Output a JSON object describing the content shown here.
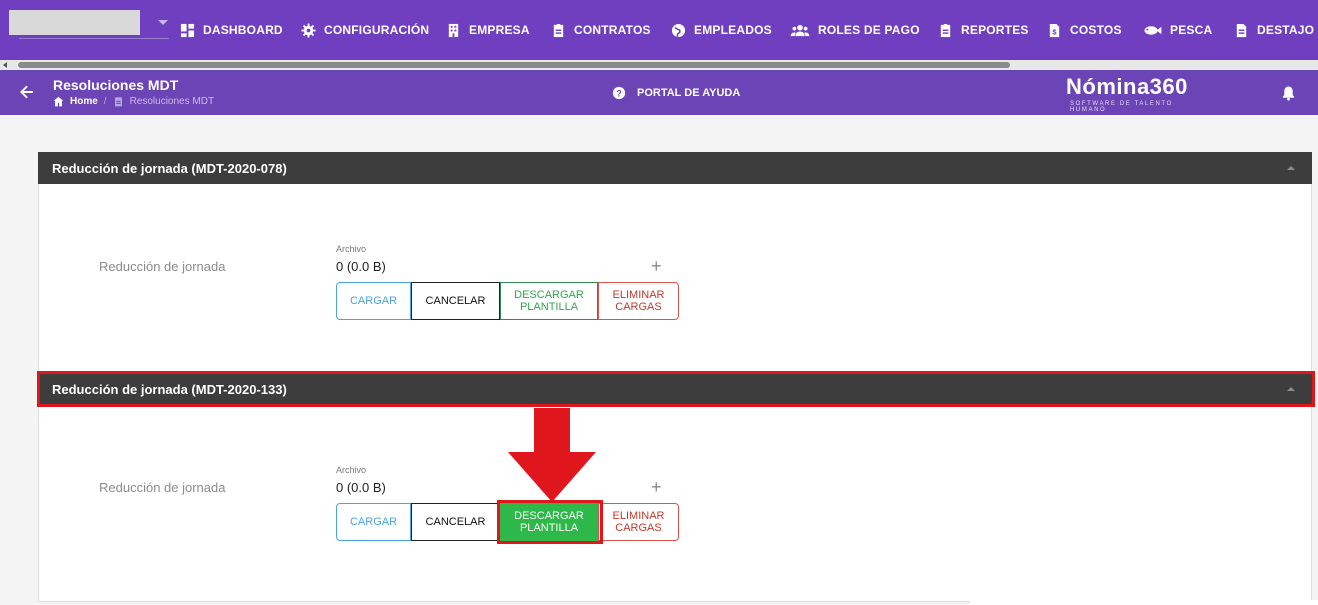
{
  "nav": {
    "items": [
      {
        "label": "DASHBOARD",
        "icon": "dashboard-icon"
      },
      {
        "label": "CONFIGURACIÓN",
        "icon": "gear-icon"
      },
      {
        "label": "EMPRESA",
        "icon": "building-icon"
      },
      {
        "label": "CONTRATOS",
        "icon": "clipboard-icon"
      },
      {
        "label": "EMPLEADOS",
        "icon": "globe-icon"
      },
      {
        "label": "ROLES DE PAGO",
        "icon": "users-icon"
      },
      {
        "label": "REPORTES",
        "icon": "clipboard-icon"
      },
      {
        "label": "COSTOS",
        "icon": "money-file-icon"
      },
      {
        "label": "PESCA",
        "icon": "fish-icon"
      },
      {
        "label": "DESTAJO",
        "icon": "file-icon"
      }
    ]
  },
  "header": {
    "title": "Resoluciones MDT",
    "breadcrumb_home": "Home",
    "breadcrumb_sep": "/",
    "breadcrumb_current": "Resoluciones MDT",
    "help_label": "PORTAL DE AYUDA",
    "logo_text": "Nómina360",
    "logo_tagline": "SOFTWARE DE TALENTO HUMANO"
  },
  "sections": [
    {
      "title": "Reducción de jornada (MDT-2020-078)",
      "row_label": "Reducción de jornada",
      "file_label": "Archivo",
      "file_value": "0 (0.0 B)",
      "buttons": {
        "cargar": "CARGAR",
        "cancelar": "CANCELAR",
        "descargar": "DESCARGAR PLANTILLA",
        "eliminar": "ELIMINAR CARGAS"
      }
    },
    {
      "title": "Reducción de jornada (MDT-2020-133)",
      "row_label": "Reducción de jornada",
      "file_label": "Archivo",
      "file_value": "0 (0.0 B)",
      "buttons": {
        "cargar": "CARGAR",
        "cancelar": "CANCELAR",
        "descargar": "DESCARGAR PLANTILLA",
        "eliminar": "ELIMINAR CARGAS"
      }
    }
  ],
  "colors": {
    "nav_bg": "#6f3fc0",
    "subheader_bg": "#6b44b6",
    "section_bg": "#3d3d3d",
    "highlight": "#e0161d",
    "success": "#2eb84a"
  }
}
